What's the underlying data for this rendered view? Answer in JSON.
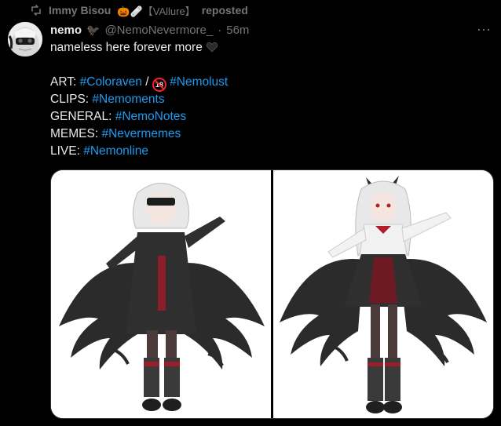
{
  "repost": {
    "reposter_name": "Immy Bisou",
    "reposter_emoji": "🎃🩹【VAllure】",
    "label": "reposted"
  },
  "post": {
    "display_name": "nemo",
    "name_emoji": "🐦‍⬛",
    "handle": "@NemoNevermore_",
    "separator": "·",
    "time": "56m",
    "more_label": "···",
    "lines": {
      "bio": "nameless here forever more",
      "art_label": "ART: ",
      "art_tag1": "#Coloraven",
      "art_sep": " / ",
      "art_tag2": "#Nemolust",
      "clips_label": "CLIPS: ",
      "clips_tag": "#Nemoments",
      "general_label": "GENERAL: ",
      "general_tag": "#NemoNotes",
      "memes_label": "MEMES: ",
      "memes_tag": "#Nevermemes",
      "live_label": "LIVE: ",
      "live_tag": "#Nemonline"
    },
    "no18_badge": "18"
  },
  "colors": {
    "background": "#000000",
    "text": "#e7e9ea",
    "muted": "#71767b",
    "link": "#1d9bf0"
  },
  "icons": {
    "repost": "repost-icon",
    "heart": "black-heart-icon",
    "more": "more-icon"
  }
}
